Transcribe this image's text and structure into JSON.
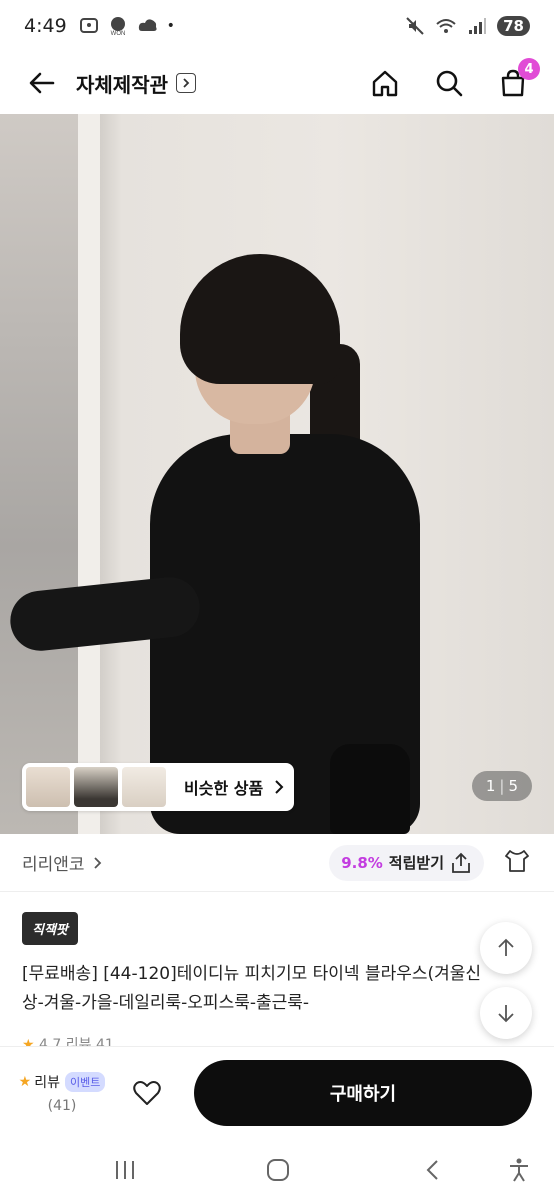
{
  "status_bar": {
    "time": "4:49",
    "battery": "78"
  },
  "header": {
    "title": "자체제작관",
    "cart_count": "4"
  },
  "hero": {
    "similar_label": "비슷한 상품",
    "pager_current": "1",
    "pager_total": "5"
  },
  "store": {
    "name": "리리앤코",
    "points_pct": "9.8%",
    "points_label": "적립받기"
  },
  "product": {
    "badge": "직잭팟",
    "title": "[무료배송] [44-120]테이디뉴 피치기모 타이넥 블라우스(겨울신상-겨울-가을-데일리룩-오피스룩-출근룩-",
    "rating": "4.7",
    "review_text": "리뷰 41"
  },
  "action_bar": {
    "review_label": "리뷰",
    "event_label": "이벤트",
    "review_count": "(41)",
    "buy_label": "구매하기"
  },
  "colors": {
    "accent": "#c33de0",
    "badge_pink": "#e14bd6",
    "buy_bg": "#0d0d0d"
  }
}
